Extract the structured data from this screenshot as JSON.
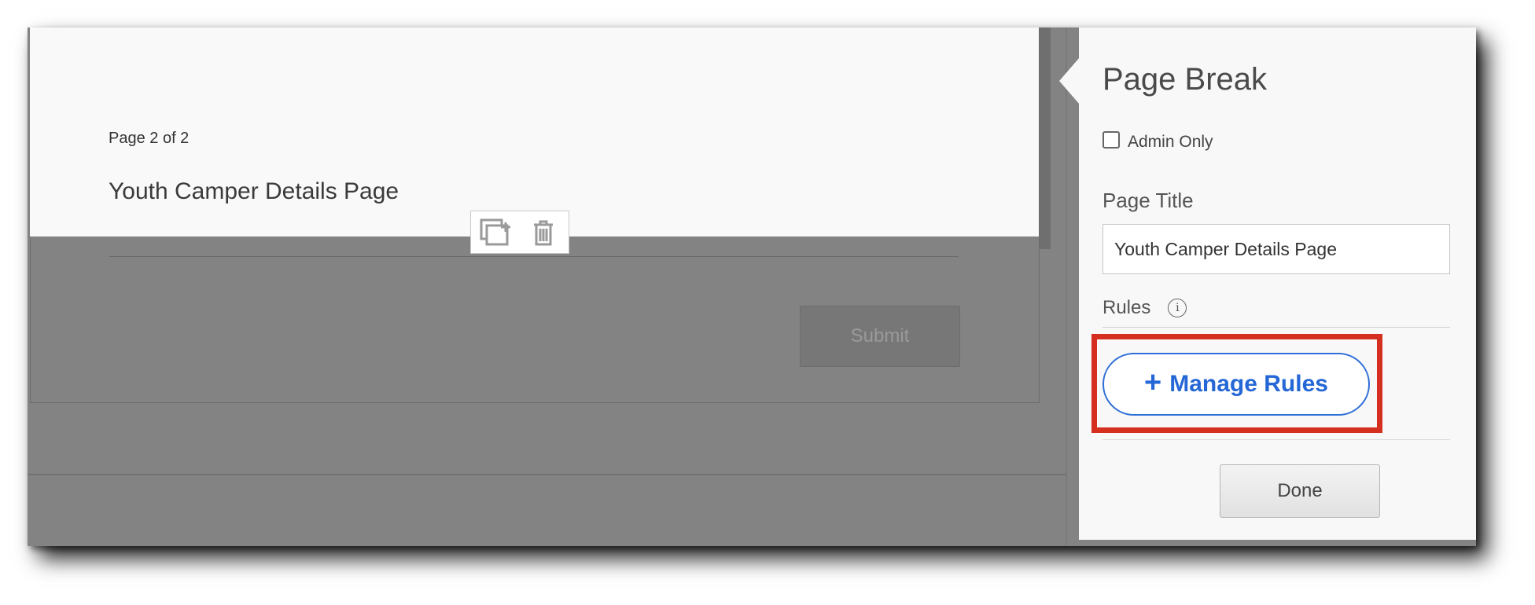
{
  "form": {
    "page_count": "Page 2 of 2",
    "page_heading": "Youth Camper Details Page",
    "submit_label": "Submit",
    "tools": {
      "duplicate_icon": "duplicate-icon",
      "delete_icon": "trash-icon"
    }
  },
  "panel": {
    "title": "Page Break",
    "admin_only_label": "Admin Only",
    "admin_only_checked": false,
    "page_title_label": "Page Title",
    "page_title_value": "Youth Camper Details Page",
    "rules_label": "Rules",
    "rules_info_icon": "info-icon",
    "manage_rules_label": "Manage Rules",
    "done_label": "Done"
  },
  "colors": {
    "overlay": "#838384",
    "accent_blue": "#2567d6",
    "highlight_red": "#d5301f",
    "panel_bg": "#f8f8f8"
  }
}
